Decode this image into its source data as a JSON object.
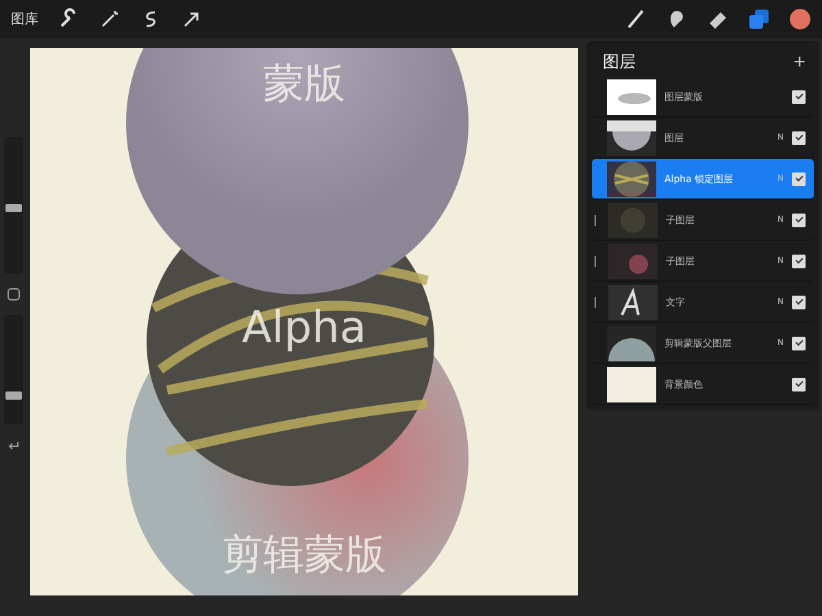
{
  "toolbar": {
    "gallery": "图库"
  },
  "sidebar": {
    "size_slider": {
      "level": 0.48
    },
    "opacity_slider": {
      "level": 0.24
    }
  },
  "canvas": {
    "labels": [
      "蒙版",
      "Alpha",
      "剪辑蒙版"
    ]
  },
  "layers_panel": {
    "title": "图层",
    "add": "+",
    "layers": [
      {
        "name": "图层蒙版",
        "kind": "mask",
        "clipped": false,
        "selected": false,
        "visible": true
      },
      {
        "name": "图层",
        "blend_mode": "N",
        "kind": "top-circle",
        "clipped": false,
        "selected": false,
        "visible": true
      },
      {
        "name": "Alpha 锁定图层",
        "blend_mode": "N",
        "kind": "sphere",
        "clipped": false,
        "selected": true,
        "visible": true
      },
      {
        "name": "子图层",
        "blend_mode": "N",
        "kind": "blur-yellow",
        "clipped": true,
        "selected": false,
        "visible": true
      },
      {
        "name": "子图层",
        "blend_mode": "N",
        "kind": "blur-red",
        "clipped": true,
        "selected": false,
        "visible": true
      },
      {
        "name": "文字",
        "blend_mode": "N",
        "kind": "text",
        "clipped": true,
        "selected": false,
        "visible": true
      },
      {
        "name": "剪辑蒙版父图层",
        "blend_mode": "N",
        "kind": "dome",
        "clipped": false,
        "selected": false,
        "visible": true
      },
      {
        "name": "背景颜色",
        "kind": "solid",
        "clipped": false,
        "selected": false,
        "visible": true
      }
    ]
  }
}
